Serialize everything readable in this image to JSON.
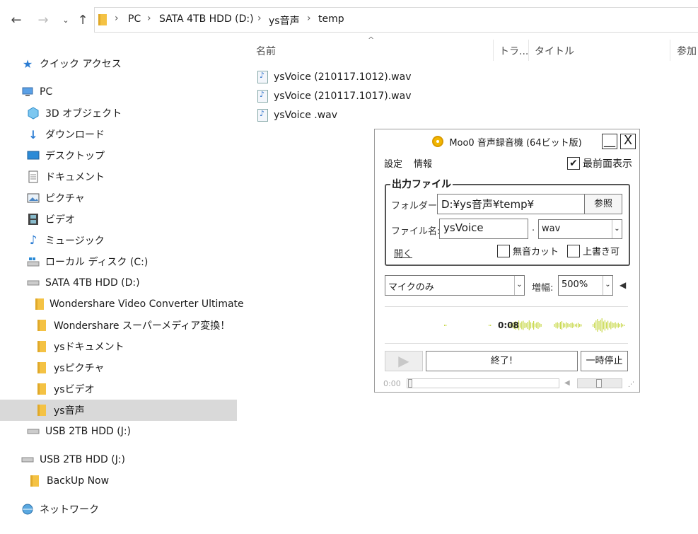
{
  "explorer": {
    "breadcrumb": [
      "PC",
      "SATA 4TB HDD (D:)",
      "ys音声",
      "temp"
    ],
    "nav": [
      {
        "label": "クイック アクセス",
        "icon": "star-icon"
      },
      {
        "label": "PC",
        "icon": "pc-icon"
      },
      {
        "label": "3D オブジェクト",
        "icon": "cube-icon"
      },
      {
        "label": "ダウンロード",
        "icon": "download-arrow-icon"
      },
      {
        "label": "デスクトップ",
        "icon": "desktop-icon"
      },
      {
        "label": "ドキュメント",
        "icon": "document-icon"
      },
      {
        "label": "ピクチャ",
        "icon": "picture-icon"
      },
      {
        "label": "ビデオ",
        "icon": "film-icon"
      },
      {
        "label": "ミュージック",
        "icon": "music-note-icon"
      },
      {
        "label": "ローカル ディスク (C:)",
        "icon": "windows-drive-icon"
      },
      {
        "label": "SATA 4TB HDD (D:)",
        "icon": "drive-icon"
      },
      {
        "label": "Wondershare Video Converter Ultimate",
        "icon": "folder-icon"
      },
      {
        "label": "Wondershare スーパーメディア変換！",
        "icon": "folder-icon"
      },
      {
        "label": "ysドキュメント",
        "icon": "folder-icon"
      },
      {
        "label": "ysピクチャ",
        "icon": "folder-icon"
      },
      {
        "label": "ysビデオ",
        "icon": "folder-icon"
      },
      {
        "label": "ys音声",
        "icon": "folder-icon"
      },
      {
        "label": "USB 2TB HDD (J:)",
        "icon": "drive-icon"
      },
      {
        "label": "USB 2TB HDD (J:)",
        "icon": "drive-icon"
      },
      {
        "label": "BackUp Now",
        "icon": "folder-icon"
      },
      {
        "label": "ネットワーク",
        "icon": "network-icon"
      }
    ],
    "columns": [
      "名前",
      "トラ...",
      "タイトル",
      "参加"
    ],
    "files": [
      "ysVoice  (210117.1012).wav",
      "ysVoice  (210117.1017).wav",
      "ysVoice .wav"
    ]
  },
  "recorder": {
    "title": "Moo0 音声録音機 (64ビット版)",
    "minimize": "__",
    "close": "X",
    "menu": [
      "設定",
      "情報"
    ],
    "always_on_top": {
      "label": "最前面表示",
      "checked": true
    },
    "output_group": "出力ファイル",
    "folder_label": "フォルダー:",
    "folder_value": "D:¥ys音声¥temp¥",
    "browse": "参照",
    "filename_label": "ファイル名:",
    "filename_value": "ysVoice",
    "dot": ".",
    "ext": "wav",
    "open_link": "開く",
    "silence_cut": {
      "label": "無音カット",
      "checked": false
    },
    "overwrite": {
      "label": "上書き可",
      "checked": false
    },
    "source": "マイクのみ",
    "gain_label": "増幅:",
    "gain_value": "500%",
    "elapsed": "0:08",
    "stop_button": "終了!",
    "pause_button": "一時停止",
    "position": "0:00",
    "accent": "#c8d84a"
  }
}
